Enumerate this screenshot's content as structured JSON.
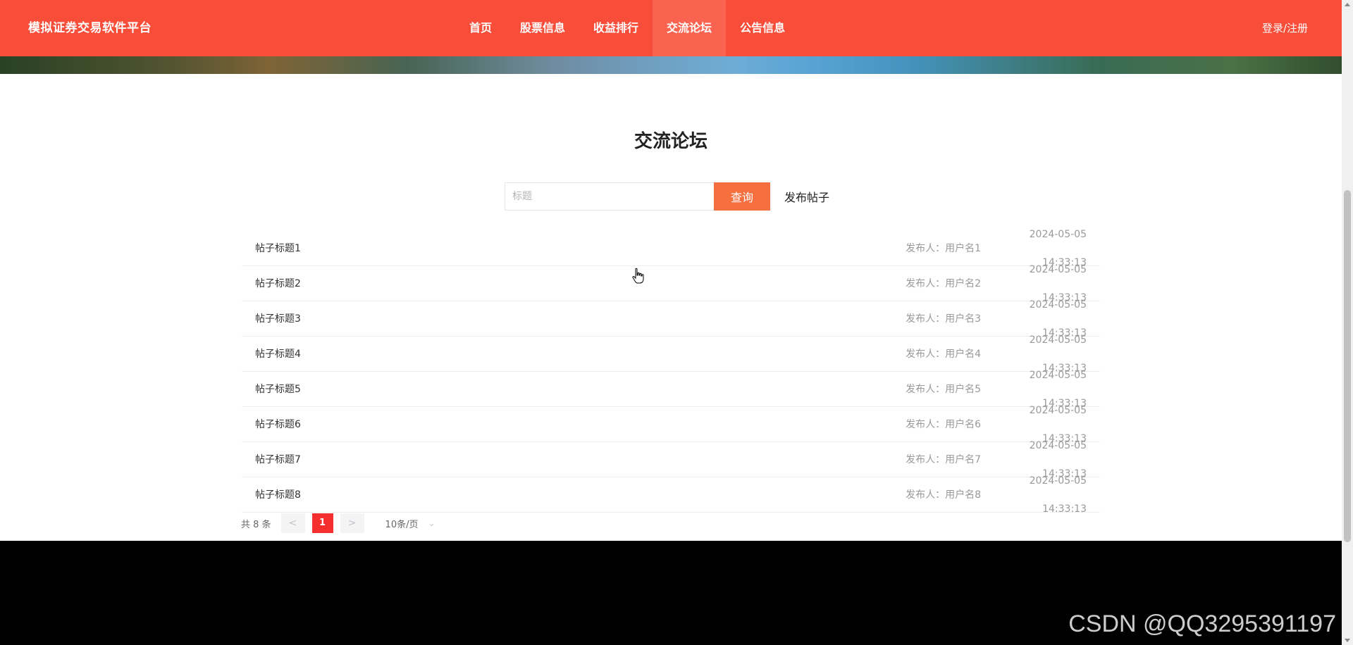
{
  "header": {
    "brand": "模拟证券交易软件平台",
    "nav": [
      "首页",
      "股票信息",
      "收益排行",
      "交流论坛",
      "公告信息"
    ],
    "active_nav": "交流论坛",
    "login": "登录/注册"
  },
  "main": {
    "title": "交流论坛",
    "search": {
      "placeholder": "标题",
      "button": "查询"
    },
    "publish": "发布帖子"
  },
  "posts": [
    {
      "title": "帖子标题1",
      "author": "发布人：用户名1",
      "time": "2024-05-05 14:33:13"
    },
    {
      "title": "帖子标题2",
      "author": "发布人：用户名2",
      "time": "2024-05-05 14:33:13"
    },
    {
      "title": "帖子标题3",
      "author": "发布人：用户名3",
      "time": "2024-05-05 14:33:13"
    },
    {
      "title": "帖子标题4",
      "author": "发布人：用户名4",
      "time": "2024-05-05 14:33:13"
    },
    {
      "title": "帖子标题5",
      "author": "发布人：用户名5",
      "time": "2024-05-05 14:33:13"
    },
    {
      "title": "帖子标题6",
      "author": "发布人：用户名6",
      "time": "2024-05-05 14:33:13"
    },
    {
      "title": "帖子标题7",
      "author": "发布人：用户名7",
      "time": "2024-05-05 14:33:13"
    },
    {
      "title": "帖子标题8",
      "author": "发布人：用户名8",
      "time": "2024-05-05 14:33:13"
    }
  ],
  "pagination": {
    "total": "共 8 条",
    "prev": "<",
    "current": "1",
    "next": ">",
    "page_size": "10条/页"
  },
  "watermark": "CSDN @QQ3295391197",
  "colors": {
    "header_bg": "#f84d39",
    "search_button": "#f56f3f",
    "page_active": "#f52e2e"
  },
  "icons": {
    "page_size_dropdown": "chevron-down-icon",
    "cursor": "hand-pointer-icon"
  }
}
